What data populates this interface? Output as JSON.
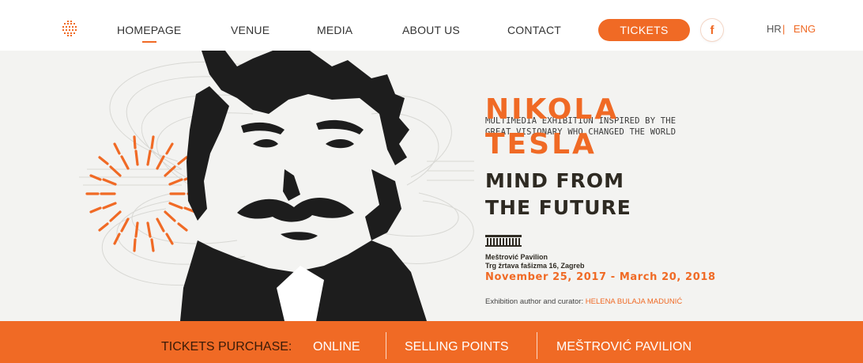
{
  "nav": {
    "logo_icon": "tesla-coil-logo-icon",
    "items": [
      {
        "label": "HOMEPAGE",
        "active": true
      },
      {
        "label": "VENUE",
        "active": false
      },
      {
        "label": "MEDIA",
        "active": false
      },
      {
        "label": "ABOUT US",
        "active": false
      },
      {
        "label": "CONTACT",
        "active": false
      }
    ],
    "tickets_button": "TICKETS",
    "facebook_glyph": "f",
    "facebook_icon": "facebook-icon",
    "languages": [
      {
        "label": "HR",
        "active": false
      },
      {
        "label": "ENG",
        "active": true
      }
    ],
    "language_separator": "|"
  },
  "hero": {
    "subtitle_line1": "MULTIMEDIA EXHIBITION INSPIRED BY THE",
    "subtitle_line2": "GREAT VISIONARY WHO CHANGED THE WORLD",
    "name_first": "NIKOLA",
    "name_last": "TESLA",
    "title_line1": "MIND FROM",
    "title_line2": "THE FUTURE",
    "venue_icon": "pavilion-icon",
    "venue_name": "Meštrović Pavilion",
    "venue_address": "Trg žrtava fašizma 16, Zagreb",
    "dates": "November 25, 2017 - March 20, 2018",
    "curator_label": "Exhibition author and curator:",
    "curator_name": "HELENA BULAJA MADUNIĆ"
  },
  "ticket_bar": {
    "label": "TICKETS PURCHASE:",
    "links": [
      "ONLINE",
      "SELLING POINTS",
      "MEŠTROVIĆ PAVILION"
    ]
  },
  "colors": {
    "accent": "#f06a25",
    "dark_text": "#2e2a22",
    "hero_background": "#f3f3f1"
  }
}
